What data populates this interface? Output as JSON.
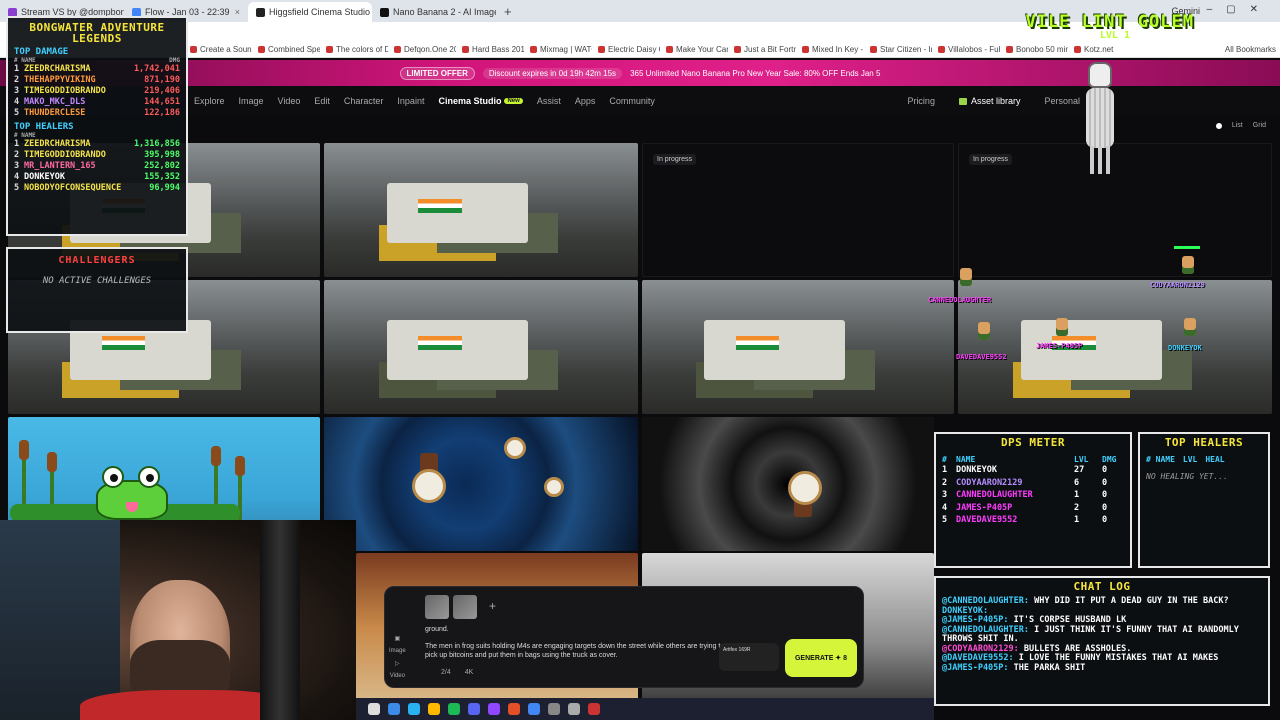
{
  "browser": {
    "tabs": [
      {
        "title": "Stream VS by @dompbongwatu",
        "color": "#8a3fd1"
      },
      {
        "title": "Flow - Jan 03 - 22:39",
        "color": "#4285f4"
      },
      {
        "title": "Higgsfield Cinema Studio | Prof",
        "color": "#222222",
        "active": true
      },
      {
        "title": "Nano Banana 2 - AI Image Gen",
        "color": "#111111"
      }
    ],
    "gemini_label": "Gemini",
    "bookmarks": [
      "Create a Sound Tea...",
      "Combined Speed Te...",
      "The colors of Defqo...",
      "Defqon.One 2013 H...",
      "Hard Bass 2013 (Liv...",
      "Mixmag | WATCH D...",
      "Electric Daisy Carniv...",
      "Make Your Car Fast...",
      "Just a Bit Fortress -...",
      "Mixed In Key - DJ S...",
      "Star Citizen - Imgur",
      "Villalobos - Fuhrsun...",
      "Bonobo 50 min F...",
      "Kotz.net"
    ],
    "all_bookmarks": "All Bookmarks"
  },
  "promo": {
    "badge": "LIMITED OFFER",
    "countdown": "Discount expires in 0d 19h 42m 15s",
    "message": "365 Unlimited Nano Banana Pro New Year Sale: 80% OFF Ends Jan 5"
  },
  "site_nav": {
    "items": [
      "Explore",
      "Image",
      "Video",
      "Edit",
      "Character",
      "Inpaint",
      "Cinema Studio",
      "Assist",
      "Apps",
      "Community"
    ],
    "active": "Cinema Studio",
    "new_badge": "New",
    "pricing": "Pricing",
    "asset_library": "Asset library",
    "workspace": "Personal",
    "view_list": "List",
    "view_grid": "Grid"
  },
  "grid": {
    "in_progress_label": "In progress"
  },
  "overlays": {
    "leaderboard": {
      "title_line1": "BONGWATER ADVENTURE",
      "title_line2": "LEGENDS",
      "damage_title": "TOP DAMAGE",
      "name_header": "# NAME",
      "dmg_header": "DMG",
      "damage": [
        {
          "rank": "1",
          "name": "ZEEDRCHARISMA",
          "value": "1,742,041",
          "color": "c-yel",
          "vcolor": "v-red"
        },
        {
          "rank": "2",
          "name": "THEHAPPYVIKING",
          "value": "871,190",
          "color": "c-org",
          "vcolor": "v-red"
        },
        {
          "rank": "3",
          "name": "TIMEGODDIOBRANDO",
          "value": "219,406",
          "color": "c-yel",
          "vcolor": "v-red"
        },
        {
          "rank": "4",
          "name": "MAKO_MKC_DLS",
          "value": "144,651",
          "color": "c-pur",
          "vcolor": "v-red"
        },
        {
          "rank": "5",
          "name": "THUNDERCLESE",
          "value": "122,186",
          "color": "c-org",
          "vcolor": "v-red"
        }
      ],
      "healers_title": "TOP HEALERS",
      "healers": [
        {
          "rank": "1",
          "name": "ZEEDRCHARISMA",
          "value": "1,316,856",
          "color": "c-yel",
          "vcolor": "v-grn"
        },
        {
          "rank": "2",
          "name": "TIMEGODDIOBRANDO",
          "value": "395,998",
          "color": "c-yel",
          "vcolor": "v-grn"
        },
        {
          "rank": "3",
          "name": "MR_LANTERN_165",
          "value": "252,802",
          "color": "c-pink",
          "vcolor": "v-grn"
        },
        {
          "rank": "4",
          "name": "DONKEYOK",
          "value": "155,352",
          "color": "c-wht",
          "vcolor": "v-grn"
        },
        {
          "rank": "5",
          "name": "NOBODYOFCONSEQUENCE",
          "value": "96,994",
          "color": "c-yel",
          "vcolor": "v-grn"
        }
      ]
    },
    "challengers": {
      "title": "CHALLENGERS",
      "status": "NO ACTIVE CHALLENGES"
    },
    "boss": {
      "name": "VILE LINT GOLEM",
      "level": "LVL 1"
    },
    "battle_sprites": [
      {
        "name": "CANNEDOLAUGHTER",
        "color": "#ff3cff"
      },
      {
        "name": "CODYAARON2129",
        "color": "#b48cff"
      },
      {
        "name": "DAVEDAVE9552",
        "color": "#ff3cff"
      },
      {
        "name": "JAMES-P405P",
        "color": "#ff3cff"
      },
      {
        "name": "DONKEYOK",
        "color": "#3fd0ff"
      }
    ],
    "dps_meter": {
      "title": "DPS METER",
      "headers": [
        "#",
        "NAME",
        "LVL",
        "DMG"
      ],
      "rows": [
        {
          "rank": "1",
          "name": "DONKEYOK",
          "lvl": "27",
          "dmg": "0",
          "color": "#ffffff"
        },
        {
          "rank": "2",
          "name": "CODYAARON2129",
          "lvl": "6",
          "dmg": "0",
          "color": "#b48cff"
        },
        {
          "rank": "3",
          "name": "CANNEDOLAUGHTER",
          "lvl": "1",
          "dmg": "0",
          "color": "#ff3cff"
        },
        {
          "rank": "4",
          "name": "JAMES-P405P",
          "lvl": "2",
          "dmg": "0",
          "color": "#ff3cff"
        },
        {
          "rank": "5",
          "name": "DAVEDAVE9552",
          "lvl": "1",
          "dmg": "0",
          "color": "#ff3cff"
        }
      ]
    },
    "top_healers_panel": {
      "title": "TOP HEALERS",
      "headers": [
        "# NAME",
        "LVL",
        "HEAL"
      ],
      "empty": "NO HEALING YET..."
    },
    "chat_log": {
      "title": "CHAT LOG",
      "lines": [
        {
          "user": "@CANNEDOLAUGHTER:",
          "msg": "WHY DID IT PUT A DEAD GUY IN THE BACK?",
          "pink": false
        },
        {
          "user": "DONKEYOK:",
          "msg": "",
          "pink": false
        },
        {
          "user": "@JAMES-P405P:",
          "msg": "IT'S CORPSE HUSBAND LK",
          "pink": false
        },
        {
          "user": "@CANNEDOLAUGHTER:",
          "msg": "I JUST THINK IT'S FUNNY THAT AI RANDOMLY THROWS SHIT IN.",
          "pink": false
        },
        {
          "user": "@CODYAARON2129:",
          "msg": "BULLETS ARE ASSHOLES.",
          "pink": true
        },
        {
          "user": "@DAVEDAVE9552:",
          "msg": "I LOVE THE FUNNY MISTAKES THAT AI MAKES",
          "pink": false
        },
        {
          "user": "@JAMES-P405P:",
          "msg": "THE PARKA SHIT",
          "pink": false
        }
      ]
    }
  },
  "prompt_box": {
    "text_line1": "ground.",
    "text_line2": "The men in frog suits holding M4s are engaging targets down the street while others are trying to pick up bitcoins and put them in bags using the truck as cover.",
    "count": "2/4",
    "resolution": "4K",
    "side_image": "Image",
    "side_video": "Video",
    "model": "Artifex 169R",
    "generate": "GENERATE ✦ 8"
  }
}
